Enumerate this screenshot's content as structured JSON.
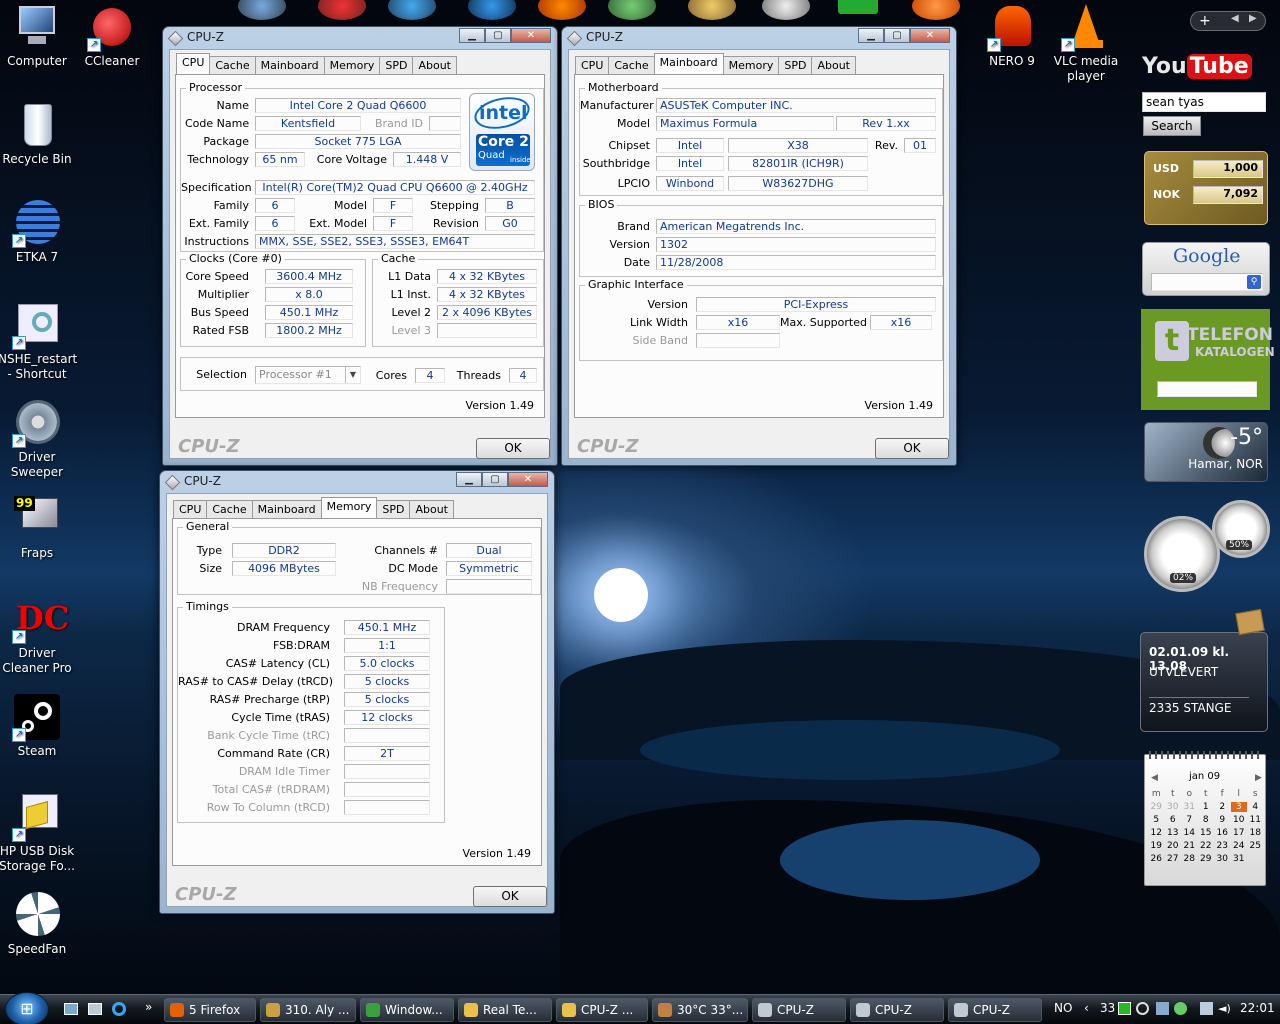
{
  "desktop_icons": [
    {
      "label": "Computer",
      "icon": "computer-icon"
    },
    {
      "label": "CCleaner",
      "icon": "ccleaner-icon"
    },
    {
      "label": "Recycle Bin",
      "icon": "recycle-bin-icon"
    },
    {
      "label": "ETKA 7",
      "icon": "etka-icon"
    },
    {
      "label": "NSHE_restart - Shortcut",
      "icon": "nshe-icon"
    },
    {
      "label": "Driver Sweeper",
      "icon": "driver-sweeper-icon"
    },
    {
      "label": "Fraps",
      "icon": "fraps-icon",
      "badge": "99"
    },
    {
      "label": "Driver Cleaner Pro",
      "icon": "driver-cleaner-icon",
      "badge": "DC"
    },
    {
      "label": "Steam",
      "icon": "steam-icon"
    },
    {
      "label": "HP USB Disk Storage Fo...",
      "icon": "hp-usb-icon"
    },
    {
      "label": "SpeedFan",
      "icon": "speedfan-icon"
    },
    {
      "label": "NERO 9",
      "icon": "nero-icon"
    },
    {
      "label": "VLC media player",
      "icon": "vlc-icon"
    }
  ],
  "cpu_window": {
    "title": "CPU-Z",
    "tabs": [
      "CPU",
      "Cache",
      "Mainboard",
      "Memory",
      "SPD",
      "About"
    ],
    "active_tab": "CPU",
    "processor": {
      "group": "Processor",
      "name_l": "Name",
      "name": "Intel Core 2 Quad Q6600",
      "codename_l": "Code Name",
      "codename": "Kentsfield",
      "brandid_l": "Brand ID",
      "package_l": "Package",
      "package": "Socket 775 LGA",
      "tech_l": "Technology",
      "tech": "65 nm",
      "voltage_l": "Core Voltage",
      "voltage": "1.448 V",
      "spec_l": "Specification",
      "spec": "Intel(R) Core(TM)2 Quad CPU    Q6600  @ 2.40GHz",
      "family_l": "Family",
      "family": "6",
      "model_l": "Model",
      "model": "F",
      "stepping_l": "Stepping",
      "stepping": "B",
      "extfamily_l": "Ext. Family",
      "extfamily": "6",
      "extmodel_l": "Ext. Model",
      "extmodel": "F",
      "revision_l": "Revision",
      "revision": "G0",
      "instr_l": "Instructions",
      "instr": "MMX, SSE, SSE2, SSE3, SSSE3, EM64T"
    },
    "logo": {
      "brand": "intel",
      "line1": "Core 2",
      "line2": "Quad",
      "line3": "inside"
    },
    "clocks": {
      "group": "Clocks (Core #0)",
      "speed_l": "Core Speed",
      "speed": "3600.4 MHz",
      "mult_l": "Multiplier",
      "mult": "x 8.0",
      "bus_l": "Bus Speed",
      "bus": "450.1 MHz",
      "fsb_l": "Rated FSB",
      "fsb": "1800.2 MHz"
    },
    "cache": {
      "group": "Cache",
      "l1d_l": "L1 Data",
      "l1d": "4 x 32 KBytes",
      "l1i_l": "L1 Inst.",
      "l1i": "4 x 32 KBytes",
      "l2_l": "Level 2",
      "l2": "2 x 4096 KBytes",
      "l3_l": "Level 3"
    },
    "selection": {
      "label": "Selection",
      "value": "Processor #1",
      "cores_l": "Cores",
      "cores": "4",
      "threads_l": "Threads",
      "threads": "4"
    },
    "version": "Version 1.49",
    "brand": "CPU-Z",
    "ok": "OK"
  },
  "mainboard_window": {
    "title": "CPU-Z",
    "tabs": [
      "CPU",
      "Cache",
      "Mainboard",
      "Memory",
      "SPD",
      "About"
    ],
    "active_tab": "Mainboard",
    "motherboard": {
      "group": "Motherboard",
      "mfr_l": "Manufacturer",
      "mfr": "ASUSTeK Computer INC.",
      "model_l": "Model",
      "model": "Maximus Formula",
      "rev": "Rev 1.xx",
      "chipset_l": "Chipset",
      "chipset_vendor": "Intel",
      "chipset": "X38",
      "rev_l": "Rev.",
      "chipset_rev": "01",
      "south_l": "Southbridge",
      "south_vendor": "Intel",
      "south": "82801IR (ICH9R)",
      "lpcio_l": "LPCIO",
      "lpcio_vendor": "Winbond",
      "lpcio": "W83627DHG"
    },
    "bios": {
      "group": "BIOS",
      "brand_l": "Brand",
      "brand": "American Megatrends Inc.",
      "version_l": "Version",
      "version": "1302",
      "date_l": "Date",
      "date": "11/28/2008"
    },
    "graphic": {
      "group": "Graphic Interface",
      "version_l": "Version",
      "version": "PCI-Express",
      "link_l": "Link Width",
      "link": "x16",
      "max_l": "Max. Supported",
      "max": "x16",
      "side_l": "Side Band"
    },
    "version": "Version 1.49",
    "brand": "CPU-Z",
    "ok": "OK"
  },
  "memory_window": {
    "title": "CPU-Z",
    "tabs": [
      "CPU",
      "Cache",
      "Mainboard",
      "Memory",
      "SPD",
      "About"
    ],
    "active_tab": "Memory",
    "general": {
      "group": "General",
      "type_l": "Type",
      "type": "DDR2",
      "size_l": "Size",
      "size": "4096 MBytes",
      "channels_l": "Channels #",
      "channels": "Dual",
      "dc_l": "DC Mode",
      "dc": "Symmetric",
      "nb_l": "NB Frequency"
    },
    "timings": {
      "group": "Timings",
      "rows": [
        {
          "label": "DRAM Frequency",
          "value": "450.1 MHz",
          "enabled": true
        },
        {
          "label": "FSB:DRAM",
          "value": "1:1",
          "enabled": true
        },
        {
          "label": "CAS# Latency (CL)",
          "value": "5.0 clocks",
          "enabled": true
        },
        {
          "label": "RAS# to CAS# Delay (tRCD)",
          "value": "5 clocks",
          "enabled": true
        },
        {
          "label": "RAS# Precharge (tRP)",
          "value": "5 clocks",
          "enabled": true
        },
        {
          "label": "Cycle Time (tRAS)",
          "value": "12 clocks",
          "enabled": true
        },
        {
          "label": "Bank Cycle Time (tRC)",
          "value": "",
          "enabled": false
        },
        {
          "label": "Command Rate (CR)",
          "value": "2T",
          "enabled": true
        },
        {
          "label": "DRAM Idle Timer",
          "value": "",
          "enabled": false
        },
        {
          "label": "Total CAS# (tRDRAM)",
          "value": "",
          "enabled": false
        },
        {
          "label": "Row To Column (tRCD)",
          "value": "",
          "enabled": false
        }
      ]
    },
    "version": "Version 1.49",
    "brand": "CPU-Z",
    "ok": "OK"
  },
  "gadgets": {
    "youtube": {
      "logo_a": "You",
      "logo_b": "Tube",
      "query": "sean tyas",
      "search": "Search"
    },
    "currency": {
      "from": "USD",
      "from_val": "1,000",
      "to": "NOK",
      "to_val": "7,092"
    },
    "google": {
      "logo": "Google"
    },
    "telefon": {
      "line1": "TELEFON",
      "line2": "KATALOGEN"
    },
    "weather": {
      "temp": "-5°",
      "place": "Hamar, NOR"
    },
    "meters": {
      "cpu": "02%",
      "ram": "50%",
      "cpu_level": 0.02,
      "ram_level": 0.5
    },
    "package": {
      "datetime": "02.01.09 kl. 13.08",
      "status": "UTVLEVERT",
      "location": "2335 STANGE"
    },
    "calendar": {
      "month": "jan 09",
      "days": [
        "m",
        "t",
        "o",
        "t",
        "f",
        "l",
        "s"
      ],
      "weeks": [
        [
          "29",
          "30",
          "31",
          "1",
          "2",
          "3",
          "4"
        ],
        [
          "5",
          "6",
          "7",
          "8",
          "9",
          "10",
          "11"
        ],
        [
          "12",
          "13",
          "14",
          "15",
          "16",
          "17",
          "18"
        ],
        [
          "19",
          "20",
          "21",
          "22",
          "23",
          "24",
          "25"
        ],
        [
          "26",
          "27",
          "28",
          "29",
          "30",
          "31",
          ""
        ]
      ],
      "today": "3"
    }
  },
  "taskbar": {
    "start": "⊞",
    "buttons": [
      {
        "label": "5 Firefox",
        "icon": "firefox-icon",
        "color": "#e66000"
      },
      {
        "label": "310. Aly ...",
        "icon": "winamp-icon",
        "color": "#caa040"
      },
      {
        "label": "Window...",
        "icon": "messenger-icon",
        "color": "#3aa23a"
      },
      {
        "label": "Real Te...",
        "icon": "folder-icon",
        "color": "#e8c04a"
      },
      {
        "label": "CPU-Z ...",
        "icon": "folder-icon",
        "color": "#e8c04a"
      },
      {
        "label": "30°C 33°...",
        "icon": "speedfan-icon",
        "color": "#c08040"
      },
      {
        "label": "CPU-Z",
        "icon": "cpuz-icon",
        "color": "#c0c8d0"
      },
      {
        "label": "CPU-Z",
        "icon": "cpuz-icon",
        "color": "#c0c8d0"
      },
      {
        "label": "CPU-Z",
        "icon": "cpuz-icon",
        "color": "#c0c8d0"
      }
    ],
    "lang": "NO",
    "tray_count": "33",
    "clock": "22:01"
  }
}
